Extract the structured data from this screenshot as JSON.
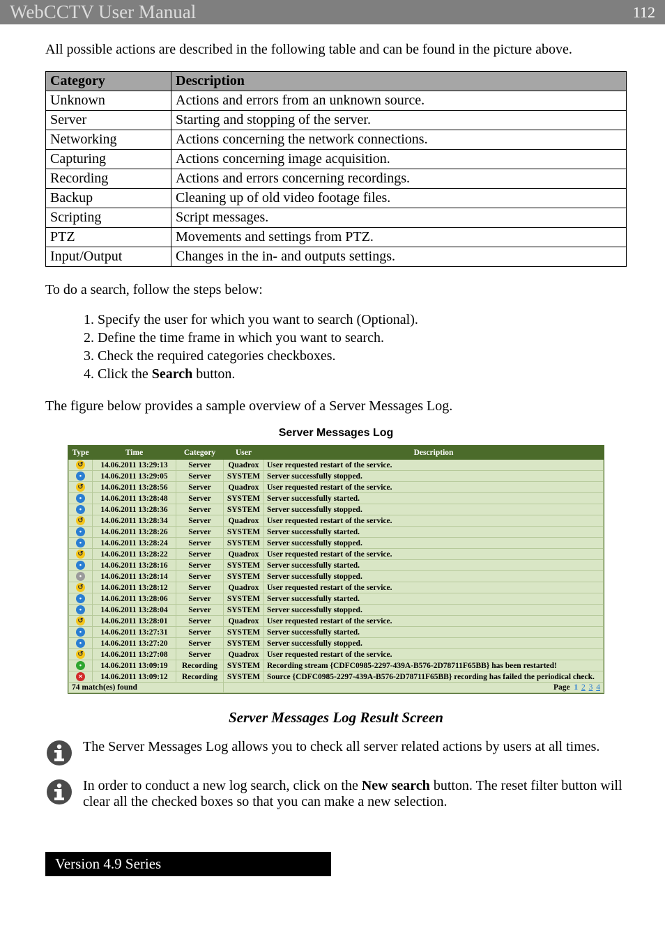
{
  "header": {
    "title": "WebCCTV User Manual",
    "page_number": "112"
  },
  "intro_text": "All possible actions are described in the following table and can be found in the picture above.",
  "cat_table": {
    "header_category": "Category",
    "header_description": "Description",
    "rows": [
      {
        "category": "Unknown",
        "description": "Actions and errors from an unknown source."
      },
      {
        "category": "Server",
        "description": "Starting and stopping of the server."
      },
      {
        "category": "Networking",
        "description": "Actions concerning the network connections."
      },
      {
        "category": "Capturing",
        "description": "Actions concerning image acquisition."
      },
      {
        "category": "Recording",
        "description": "Actions and errors concerning recordings."
      },
      {
        "category": "Backup",
        "description": "Cleaning up of old video footage files."
      },
      {
        "category": "Scripting",
        "description": "Script messages."
      },
      {
        "category": "PTZ",
        "description": "Movements and settings from PTZ."
      },
      {
        "category": "Input/Output",
        "description": "Changes in the in- and outputs settings."
      }
    ]
  },
  "steps_intro": "To do a search, follow the steps below:",
  "steps": [
    "Specify the user for which you want to search (Optional).",
    "Define the time frame in which you want to search.",
    "Check the required categories checkboxes.",
    "Click the Search button."
  ],
  "step4_prefix": "Click the ",
  "step4_bold": "Search",
  "step4_suffix": " button.",
  "figure_intro": "The figure below provides a sample overview of a Server Messages Log.",
  "log": {
    "title": "Server Messages Log",
    "headers": {
      "type": "Type",
      "time": "Time",
      "category": "Category",
      "user": "User",
      "description": "Description"
    },
    "rows": [
      {
        "icon": "wrench",
        "time": "14.06.2011 13:29:13",
        "category": "Server",
        "user": "Quadrox",
        "description": "User requested restart of the service."
      },
      {
        "icon": "blue",
        "time": "14.06.2011 13:29:05",
        "category": "Server",
        "user": "SYSTEM",
        "description": "Server successfully stopped."
      },
      {
        "icon": "wrench",
        "time": "14.06.2011 13:28:56",
        "category": "Server",
        "user": "Quadrox",
        "description": "User requested restart of the service."
      },
      {
        "icon": "blue",
        "time": "14.06.2011 13:28:48",
        "category": "Server",
        "user": "SYSTEM",
        "description": "Server successfully started."
      },
      {
        "icon": "blue",
        "time": "14.06.2011 13:28:36",
        "category": "Server",
        "user": "SYSTEM",
        "description": "Server successfully stopped."
      },
      {
        "icon": "wrench",
        "time": "14.06.2011 13:28:34",
        "category": "Server",
        "user": "Quadrox",
        "description": "User requested restart of the service."
      },
      {
        "icon": "blue",
        "time": "14.06.2011 13:28:26",
        "category": "Server",
        "user": "SYSTEM",
        "description": "Server successfully started."
      },
      {
        "icon": "blue",
        "time": "14.06.2011 13:28:24",
        "category": "Server",
        "user": "SYSTEM",
        "description": "Server successfully stopped."
      },
      {
        "icon": "wrench",
        "time": "14.06.2011 13:28:22",
        "category": "Server",
        "user": "Quadrox",
        "description": "User requested restart of the service."
      },
      {
        "icon": "blue",
        "time": "14.06.2011 13:28:16",
        "category": "Server",
        "user": "SYSTEM",
        "description": "Server successfully started."
      },
      {
        "icon": "gray",
        "time": "14.06.2011 13:28:14",
        "category": "Server",
        "user": "SYSTEM",
        "description": "Server successfully stopped."
      },
      {
        "icon": "wrench",
        "time": "14.06.2011 13:28:12",
        "category": "Server",
        "user": "Quadrox",
        "description": "User requested restart of the service."
      },
      {
        "icon": "blue",
        "time": "14.06.2011 13:28:06",
        "category": "Server",
        "user": "SYSTEM",
        "description": "Server successfully started."
      },
      {
        "icon": "blue",
        "time": "14.06.2011 13:28:04",
        "category": "Server",
        "user": "SYSTEM",
        "description": "Server successfully stopped."
      },
      {
        "icon": "wrench",
        "time": "14.06.2011 13:28:01",
        "category": "Server",
        "user": "Quadrox",
        "description": "User requested restart of the service."
      },
      {
        "icon": "blue",
        "time": "14.06.2011 13:27:31",
        "category": "Server",
        "user": "SYSTEM",
        "description": "Server successfully started."
      },
      {
        "icon": "blue",
        "time": "14.06.2011 13:27:20",
        "category": "Server",
        "user": "SYSTEM",
        "description": "Server successfully stopped."
      },
      {
        "icon": "wrench",
        "time": "14.06.2011 13:27:08",
        "category": "Server",
        "user": "Quadrox",
        "description": "User requested restart of the service."
      },
      {
        "icon": "green",
        "time": "14.06.2011 13:09:19",
        "category": "Recording",
        "user": "SYSTEM",
        "description": "Recording stream {CDFC0985-2297-439A-B576-2D78711F65BB} has been restarted!"
      },
      {
        "icon": "red",
        "time": "14.06.2011 13:09:12",
        "category": "Recording",
        "user": "SYSTEM",
        "description": "Source {CDFC0985-2297-439A-B576-2D78711F65BB} recording has failed the periodical check."
      }
    ],
    "footer": {
      "match_text": "74 match(es) found",
      "page_label": "Page",
      "pages": [
        "1",
        "2",
        "3",
        "4"
      ]
    }
  },
  "result_title": "Server Messages Log Result Screen",
  "note1": "The Server Messages Log allows you to check all server related actions by users at all times.",
  "note2_prefix": "In order to conduct a new log search, click on the ",
  "note2_bold": "New search",
  "note2_suffix": " button. The reset filter button will clear all the checked boxes so that you can make a new selection.",
  "version_bar": "Version 4.9 Series"
}
